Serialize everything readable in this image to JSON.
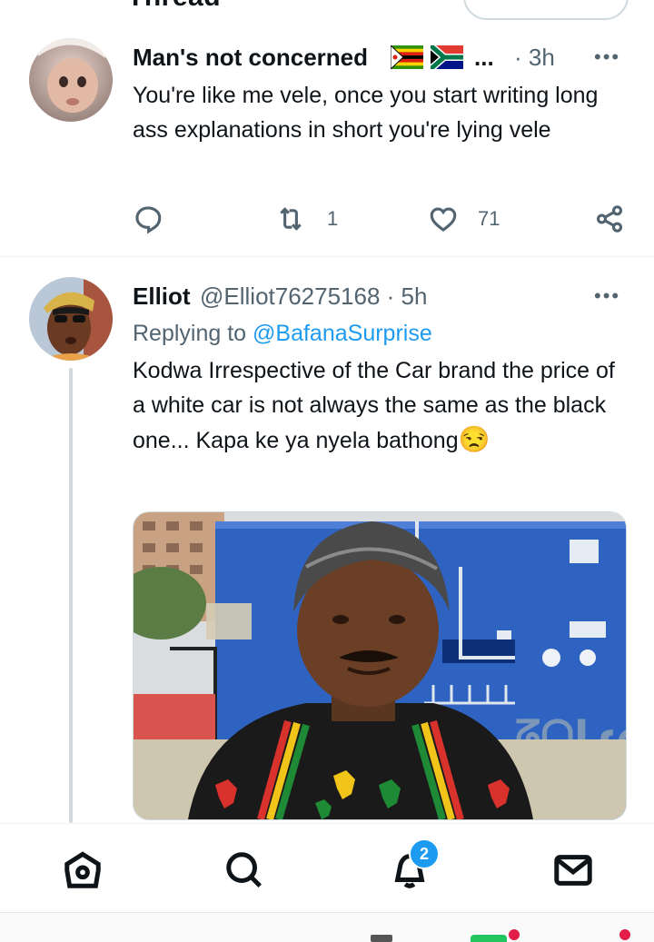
{
  "header": {
    "title": "Thread"
  },
  "tweets": [
    {
      "name": "Man's not concerned",
      "flags": [
        "🇿🇼",
        "🇿🇦"
      ],
      "ellipsis": "...",
      "time": "· 3h",
      "text": "You're like me vele, once you start writing long ass explanations in short you're lying vele",
      "retweets": "1",
      "likes": "71"
    },
    {
      "name": "Elliot",
      "handle": "@Elliot76275168 · 5h",
      "replying_prefix": "Replying to ",
      "replying_to": "@BafanaSurprise",
      "text": "Kodwa Irrespective of the Car brand the price of a white car is not always the same as the black one... Kapa ke ya nyela bathong",
      "emoji": "😒"
    }
  ],
  "more_glyph": "•••",
  "nav": {
    "notifications_badge": "2"
  },
  "colors": {
    "accent": "#1d9bf0",
    "muted": "#536471",
    "text": "#0f1419"
  },
  "icons": [
    "reply-icon",
    "retweet-icon",
    "like-icon",
    "share-icon",
    "home-icon",
    "search-icon",
    "notifications-icon",
    "messages-icon"
  ]
}
